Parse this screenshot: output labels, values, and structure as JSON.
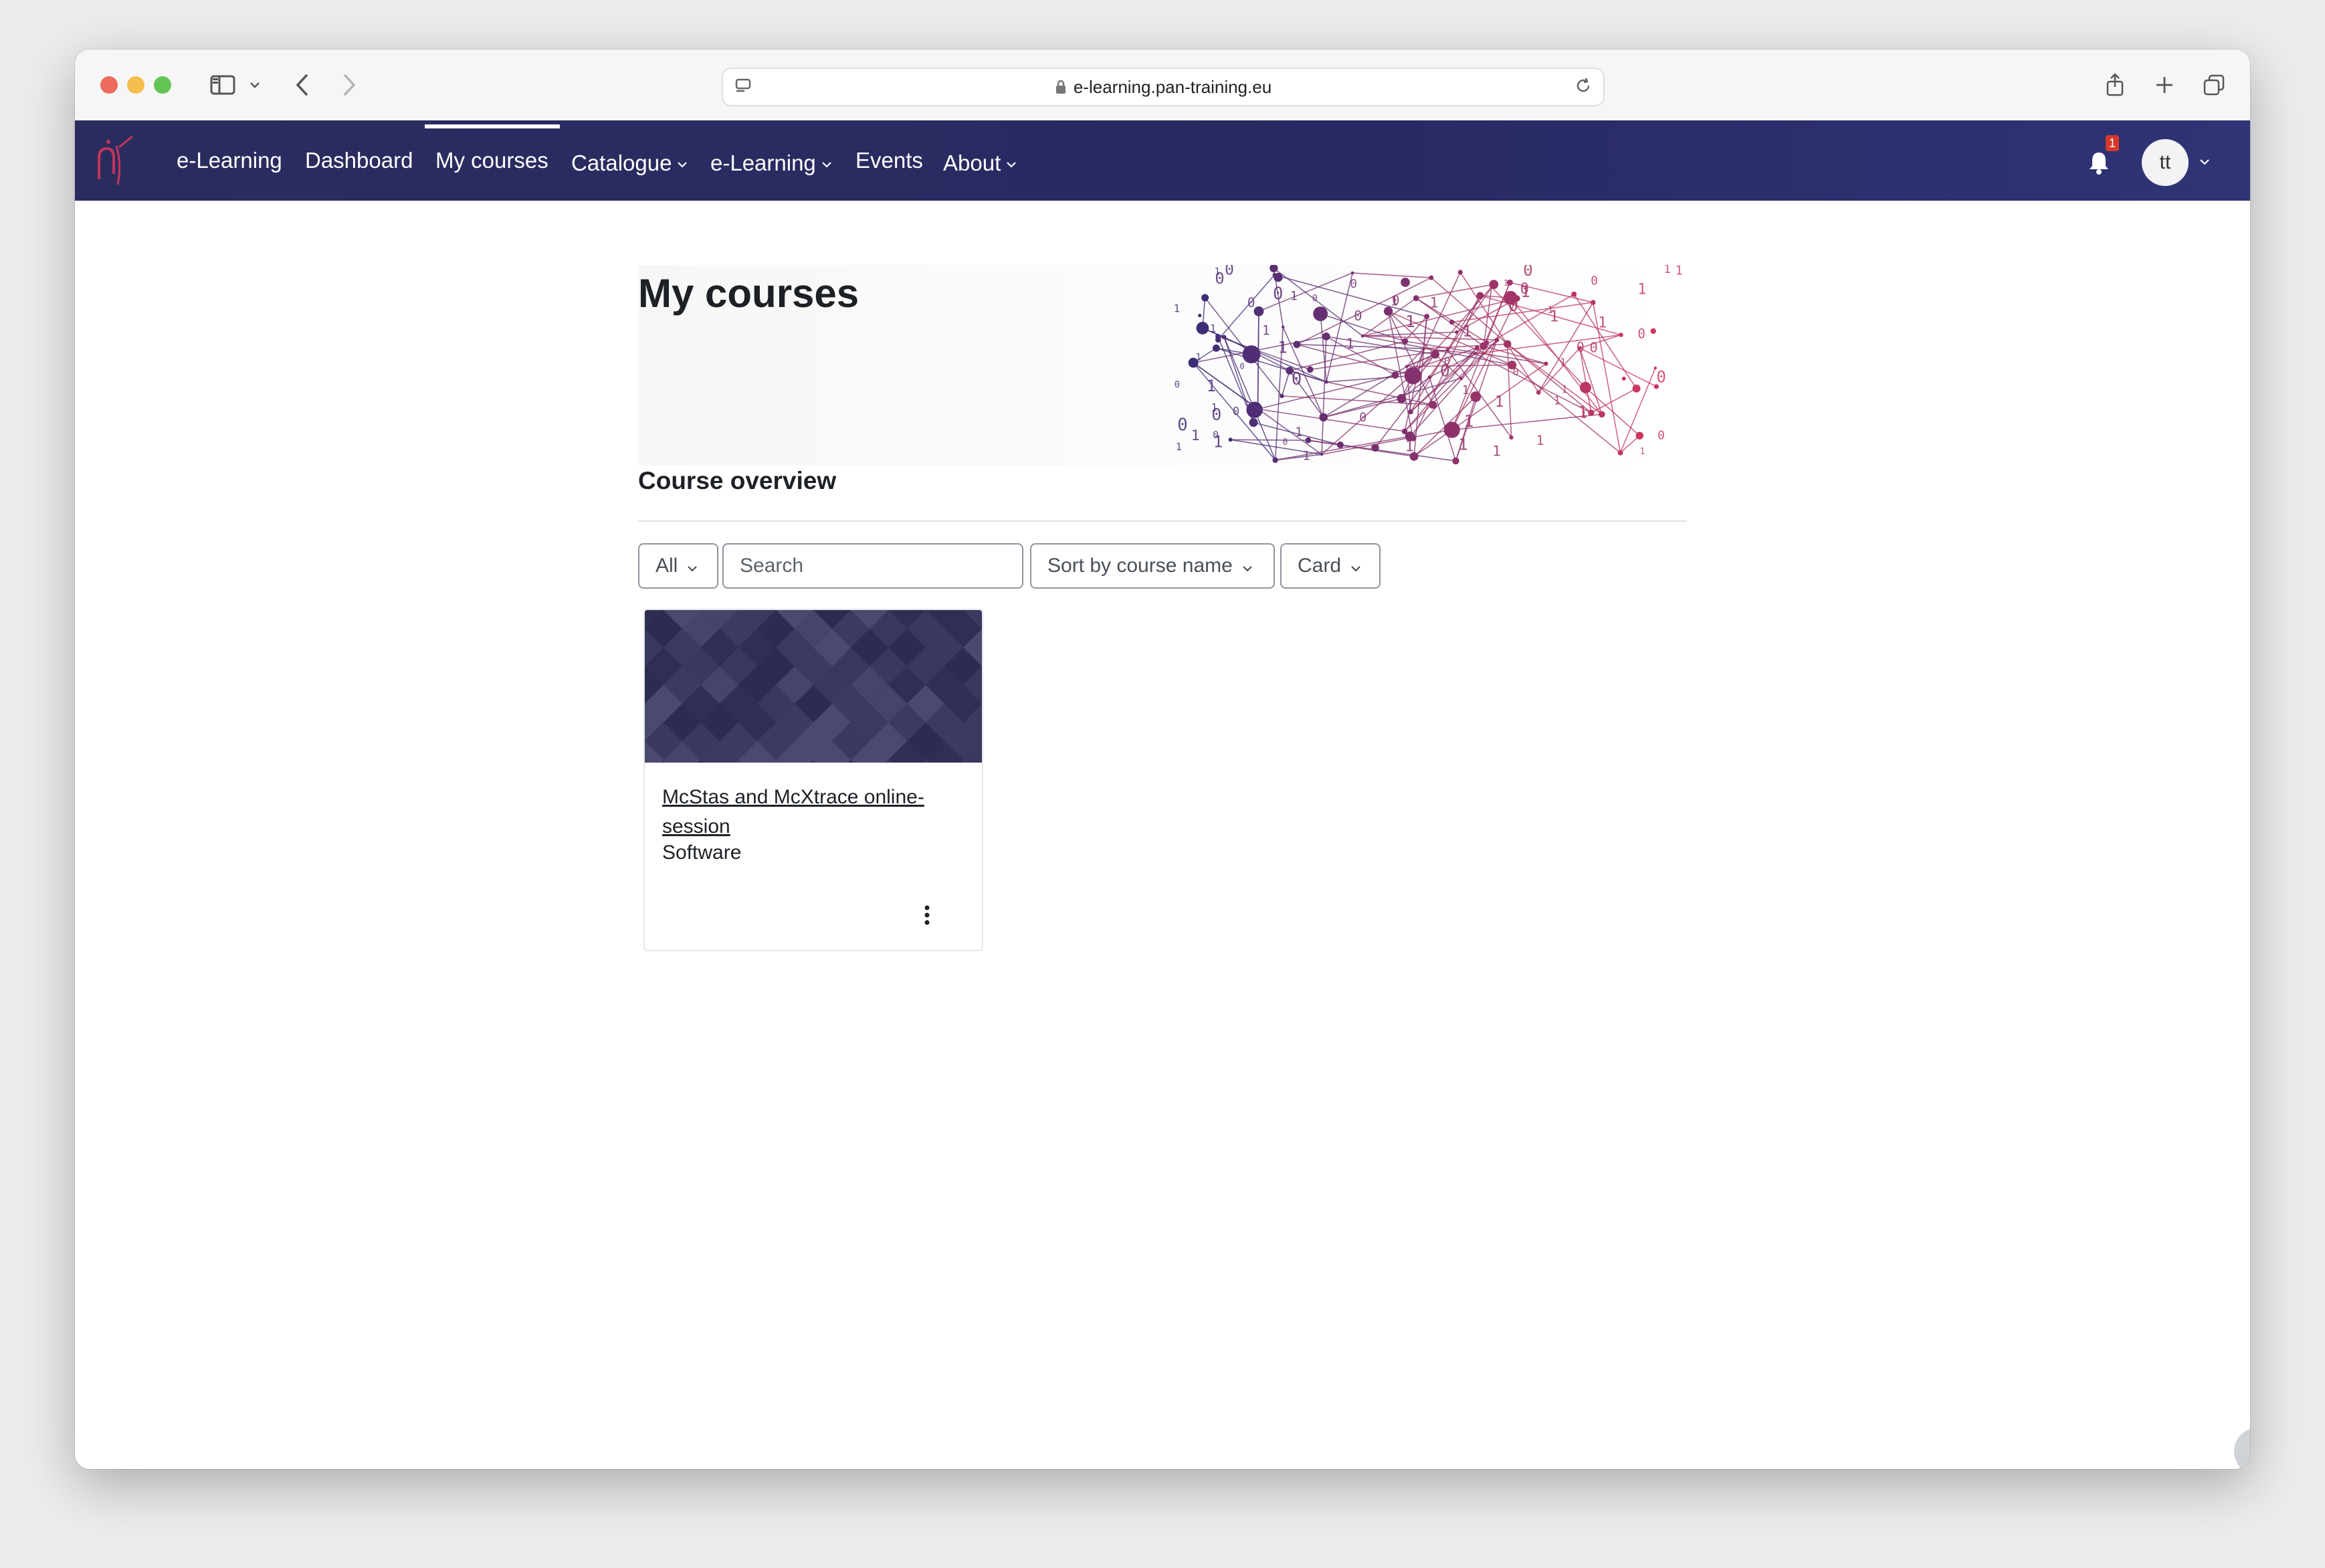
{
  "browser": {
    "url": "e-learning.pan-training.eu"
  },
  "navbar": {
    "items": [
      {
        "label": "e-Learning",
        "has_menu": false
      },
      {
        "label": "Dashboard",
        "has_menu": false
      },
      {
        "label": "My courses",
        "has_menu": false,
        "active": true
      },
      {
        "label": "Catalogue",
        "has_menu": true
      },
      {
        "label": "e-Learning",
        "has_menu": true
      },
      {
        "label": "Events",
        "has_menu": false
      },
      {
        "label": "About",
        "has_menu": true
      }
    ],
    "notification_count": "1",
    "user_initials": "tt",
    "colors": {
      "bar": "#2b2c5e",
      "accent": "#c2355a"
    }
  },
  "page": {
    "title": "My courses",
    "section_title": "Course overview"
  },
  "controls": {
    "filter_selected": "All",
    "search_placeholder": "Search",
    "sort_selected": "Sort by course name",
    "view_selected": "Card"
  },
  "courses": [
    {
      "name": "McStas and McXtrace online-session",
      "category": "Software"
    }
  ],
  "help": {
    "label": "?"
  }
}
